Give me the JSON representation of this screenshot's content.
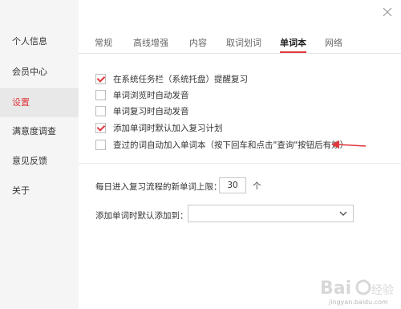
{
  "sidebar": {
    "items": [
      {
        "label": "个人信息"
      },
      {
        "label": "会员中心"
      },
      {
        "label": "设置"
      },
      {
        "label": "满意度调查"
      },
      {
        "label": "意见反馈"
      },
      {
        "label": "关于"
      }
    ],
    "active_index": 2
  },
  "tabs": [
    {
      "label": "常规"
    },
    {
      "label": "高线增强"
    },
    {
      "label": "内容"
    },
    {
      "label": "取词划词"
    },
    {
      "label": "单词本"
    },
    {
      "label": "网络"
    }
  ],
  "active_tab": "单词本",
  "options": [
    {
      "label": "在系统任务栏（系统托盘）提醒复习",
      "checked": true
    },
    {
      "label": "单词浏览时自动发音",
      "checked": false
    },
    {
      "label": "单词复习时自动发音",
      "checked": false
    },
    {
      "label": "添加单词时默认加入复习计划",
      "checked": true
    },
    {
      "label": "查过的词自动加入单词本（按下回车和点击\"查询\"按钮后有效）",
      "checked": false
    }
  ],
  "review_limit": {
    "label": "每日进入复习流程的新单词上限：",
    "value": "30",
    "unit": "个"
  },
  "default_add": {
    "label": "添加单词时默认添加到：",
    "value": ""
  },
  "watermark": {
    "text": "jingyan.baidu.com"
  },
  "colors": {
    "accent": "#e0383e",
    "sidebar_bg": "#f5f5f5"
  }
}
